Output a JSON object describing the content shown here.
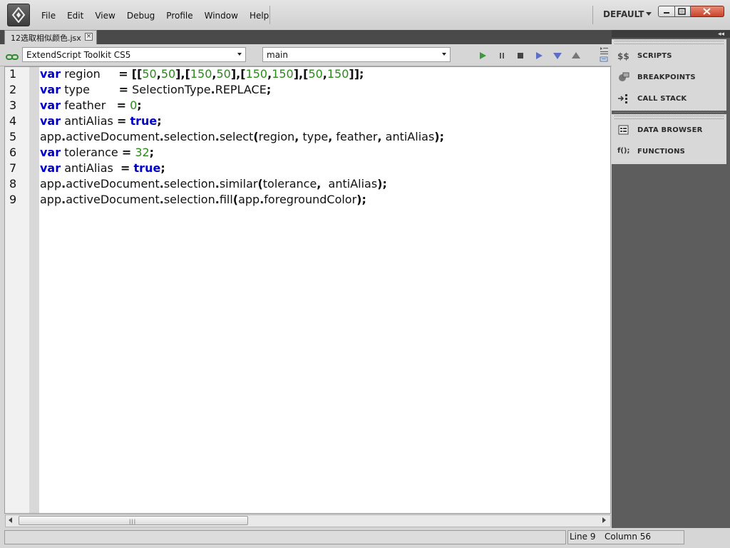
{
  "menu": {
    "items": [
      "File",
      "Edit",
      "View",
      "Debug",
      "Profile",
      "Window",
      "Help"
    ]
  },
  "workspace": {
    "label": "DEFAULT"
  },
  "editor_tab": {
    "label": "12选取相似颜色.jsx"
  },
  "toolbar": {
    "target": "ExtendScript Toolkit CS5",
    "function": "main"
  },
  "code": {
    "line_numbers": [
      "1",
      "2",
      "3",
      "4",
      "5",
      "6",
      "7",
      "8",
      "9"
    ]
  },
  "status": {
    "line": "Line 9",
    "column": "Column 56"
  },
  "panels": {
    "scripts": "SCRIPTS",
    "breakpoints": "BREAKPOINTS",
    "call_stack": "CALL STACK",
    "data_browser": "DATA BROWSER",
    "functions": "FUNCTIONS",
    "functions_icon": "f();"
  },
  "colors": {
    "keyword": "#0000cc",
    "number": "#2a8a1a",
    "panel_bg": "#5d5d5d"
  }
}
